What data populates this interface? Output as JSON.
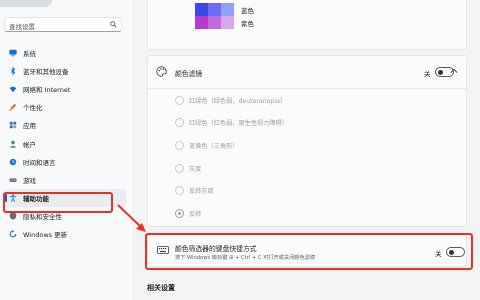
{
  "sidebar": {
    "search_placeholder": "查找设置",
    "items": [
      {
        "label": "系统",
        "icon": "monitor-icon",
        "color": "#1b6fc2"
      },
      {
        "label": "蓝牙和其他设备",
        "icon": "bluetooth-icon",
        "color": "#1b6fc2"
      },
      {
        "label": "网络和 Internet",
        "icon": "wifi-icon",
        "color": "#1b6fc2"
      },
      {
        "label": "个性化",
        "icon": "brush-icon",
        "color": "#e0702a"
      },
      {
        "label": "应用",
        "icon": "apps-icon",
        "color": "#3b6ea5"
      },
      {
        "label": "帐户",
        "icon": "account-icon",
        "color": "#2e9a5d"
      },
      {
        "label": "时间和语言",
        "icon": "clock-globe-icon",
        "color": "#1b6fc2"
      },
      {
        "label": "游戏",
        "icon": "gamepad-icon",
        "color": "#6c6c6c"
      },
      {
        "label": "辅助功能",
        "icon": "accessibility-icon",
        "color": "#1b6fc2",
        "active": true
      },
      {
        "label": "隐私和安全性",
        "icon": "shield-icon",
        "color": "#6c6c6c"
      },
      {
        "label": "Windows 更新",
        "icon": "update-icon",
        "color": "#1b6fc2"
      }
    ]
  },
  "swatches": {
    "blue_label": "蓝色",
    "purple_label": "紫色",
    "colors": [
      "#3a46e6",
      "#6c6cf0",
      "#8fa0f5",
      "#b43ad0",
      "#c06ae0",
      "#d7a8ee"
    ]
  },
  "color_filter": {
    "title": "颜色滤镜",
    "toggle_state": "关",
    "options": [
      {
        "label": "红绿色（绿色弱，deuteranopia）",
        "selected": false
      },
      {
        "label": "红绿色（红色弱，原生性视力障碍）",
        "selected": false
      },
      {
        "label": "蓝黄色（三角形）",
        "selected": false
      },
      {
        "label": "灰度",
        "selected": false
      },
      {
        "label": "反转灰度",
        "selected": false
      },
      {
        "label": "反转",
        "selected": true
      }
    ]
  },
  "shortcut": {
    "title": "颜色筛选器的键盘快捷方式",
    "description": "按下 Windows 徽标键 ⊞ + Ctrl + C 可打开或关闭颜色滤镜",
    "toggle_state": "关"
  },
  "related_settings": "相关设置",
  "accent_color": "#e3322b"
}
